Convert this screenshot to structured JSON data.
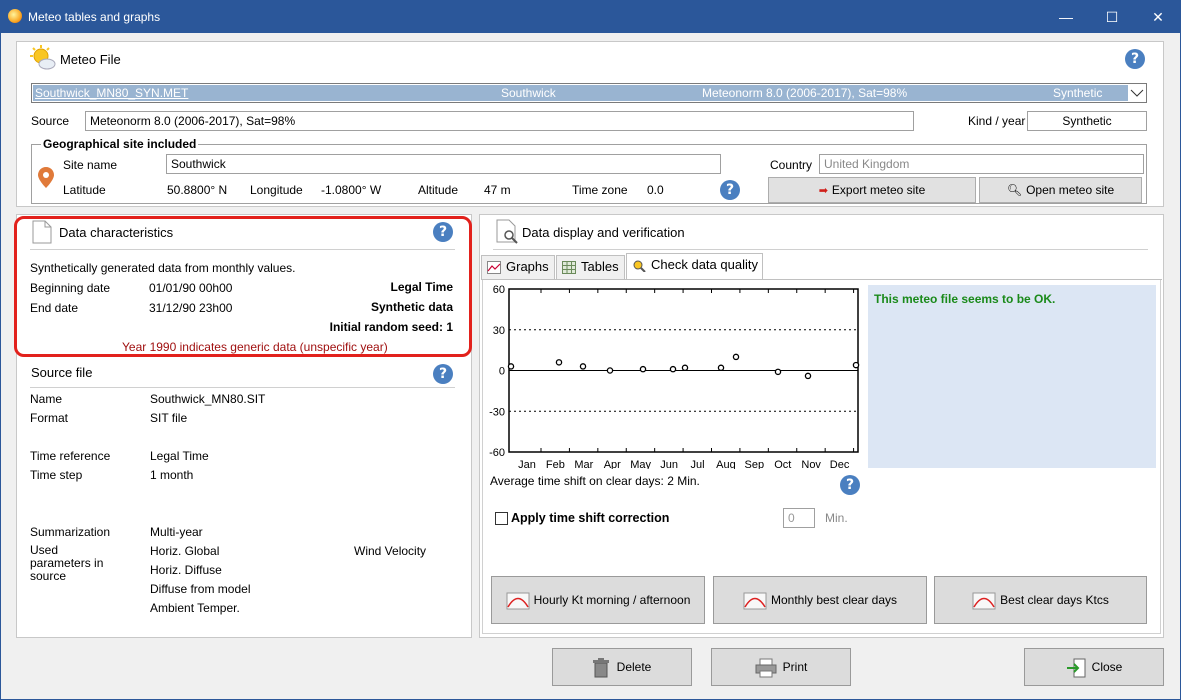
{
  "window": {
    "title": "Meteo tables and graphs",
    "minimize": "—",
    "maximize": "☐",
    "close": "✕"
  },
  "meteo_file": {
    "header": "Meteo File",
    "selector": {
      "file": "Southwick_MN80_SYN.MET",
      "site": "Southwick",
      "source": "Meteonorm 8.0 (2006-2017), Sat=98%",
      "kind": "Synthetic"
    },
    "source_label": "Source",
    "source_value": "Meteonorm 8.0 (2006-2017), Sat=98%",
    "kind_label": "Kind / year",
    "kind_value": "Synthetic",
    "geo": {
      "legend": "Geographical site included",
      "site_name_label": "Site name",
      "site_name_value": "Southwick",
      "country_label": "Country",
      "country_value": "United Kingdom",
      "latitude_label": "Latitude",
      "latitude_value": "50.8800° N",
      "longitude_label": "Longitude",
      "longitude_value": "-1.0800° W",
      "altitude_label": "Altitude",
      "altitude_value": "47 m",
      "timezone_label": "Time zone",
      "timezone_value": "0.0",
      "export_button": "Export meteo site",
      "open_button": "Open meteo site"
    }
  },
  "data_characteristics": {
    "header": "Data characteristics",
    "description": "Synthetically generated data from monthly values.",
    "begin_label": "Beginning date",
    "begin_value": "01/01/90 00h00",
    "end_label": "End date",
    "end_value": "31/12/90 23h00",
    "legal_time": "Legal Time",
    "synthetic_data": "Synthetic data",
    "seed": "Initial random seed: 1",
    "note": "Year 1990 indicates generic data (unspecific year)"
  },
  "source_file": {
    "header": "Source file",
    "name_label": "Name",
    "name_value": "Southwick_MN80.SIT",
    "format_label": "Format",
    "format_value": "SIT file",
    "timeref_label": "Time reference",
    "timeref_value": "Legal Time",
    "timestep_label": "Time step",
    "timestep_value": "1 month",
    "summ_label": "Summarization",
    "summ_value": "Multi-year",
    "used_label": "Used parameters in source",
    "params": [
      "Horiz. Global",
      "Horiz. Diffuse",
      "Diffuse from model",
      "Ambient Temper."
    ],
    "param_extra": "Wind Velocity"
  },
  "display": {
    "header": "Data display and verification",
    "tabs": [
      "Graphs",
      "Tables",
      "Check data quality"
    ],
    "status": "This meteo file seems to be OK.",
    "avg_shift": "Average time shift on clear days: 2 Min.",
    "apply_label": "Apply time shift correction",
    "shift_value": "0",
    "shift_unit": "Min.",
    "buttons": [
      "Hourly Kt morning / afternoon",
      "Monthly best clear days",
      "Best clear days Ktcs"
    ]
  },
  "footer": {
    "delete": "Delete",
    "print": "Print",
    "close": "Close"
  },
  "chart_data": {
    "type": "scatter",
    "categories": [
      "Jan",
      "Feb",
      "Mar",
      "Apr",
      "May",
      "Jun",
      "Jul",
      "Aug",
      "Sep",
      "Oct",
      "Nov",
      "Dec"
    ],
    "y_ticks": [
      60,
      30,
      0,
      -30,
      -60
    ],
    "ylim": [
      -60,
      60
    ],
    "x": [
      0.0,
      1.6,
      2.4,
      3.3,
      4.4,
      5.4,
      5.8,
      7.0,
      7.5,
      8.9,
      9.9,
      11.5
    ],
    "values": [
      3,
      6,
      3,
      0,
      1,
      1,
      2,
      2,
      10,
      -1,
      -4,
      4
    ],
    "xlim": [
      0,
      11.5
    ]
  }
}
